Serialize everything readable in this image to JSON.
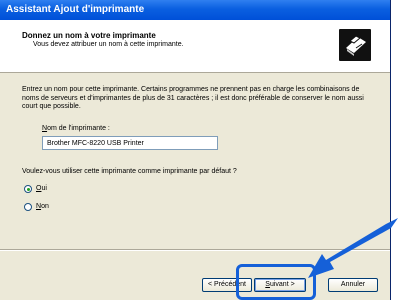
{
  "window": {
    "title": "Assistant Ajout d'imprimante"
  },
  "header": {
    "title": "Donnez un nom à votre imprimante",
    "subtitle": "Vous devez attribuer un nom à cette imprimante.",
    "icon": "printer-icon"
  },
  "content": {
    "description": "Entrez un nom pour cette imprimante. Certains programmes ne prennent pas en charge les combinaisons de noms de serveurs et d'imprimantes de plus de 31 caractères ; il est donc préférable de conserver le nom aussi court que possible.",
    "printer_name_label": "Nom de l'imprimante :",
    "printer_name_value": "Brother MFC-8220 USB Printer",
    "default_question": "Voulez-vous utiliser cette imprimante comme imprimante par défaut ?",
    "options": [
      {
        "label": "Oui",
        "selected": true
      },
      {
        "label": "Non",
        "selected": false
      }
    ]
  },
  "buttons": {
    "back": "< Précédent",
    "next": "Suivant >",
    "cancel": "Annuler"
  },
  "colors": {
    "titlebar": "#0a5fe0",
    "highlight": "#1560d8"
  }
}
